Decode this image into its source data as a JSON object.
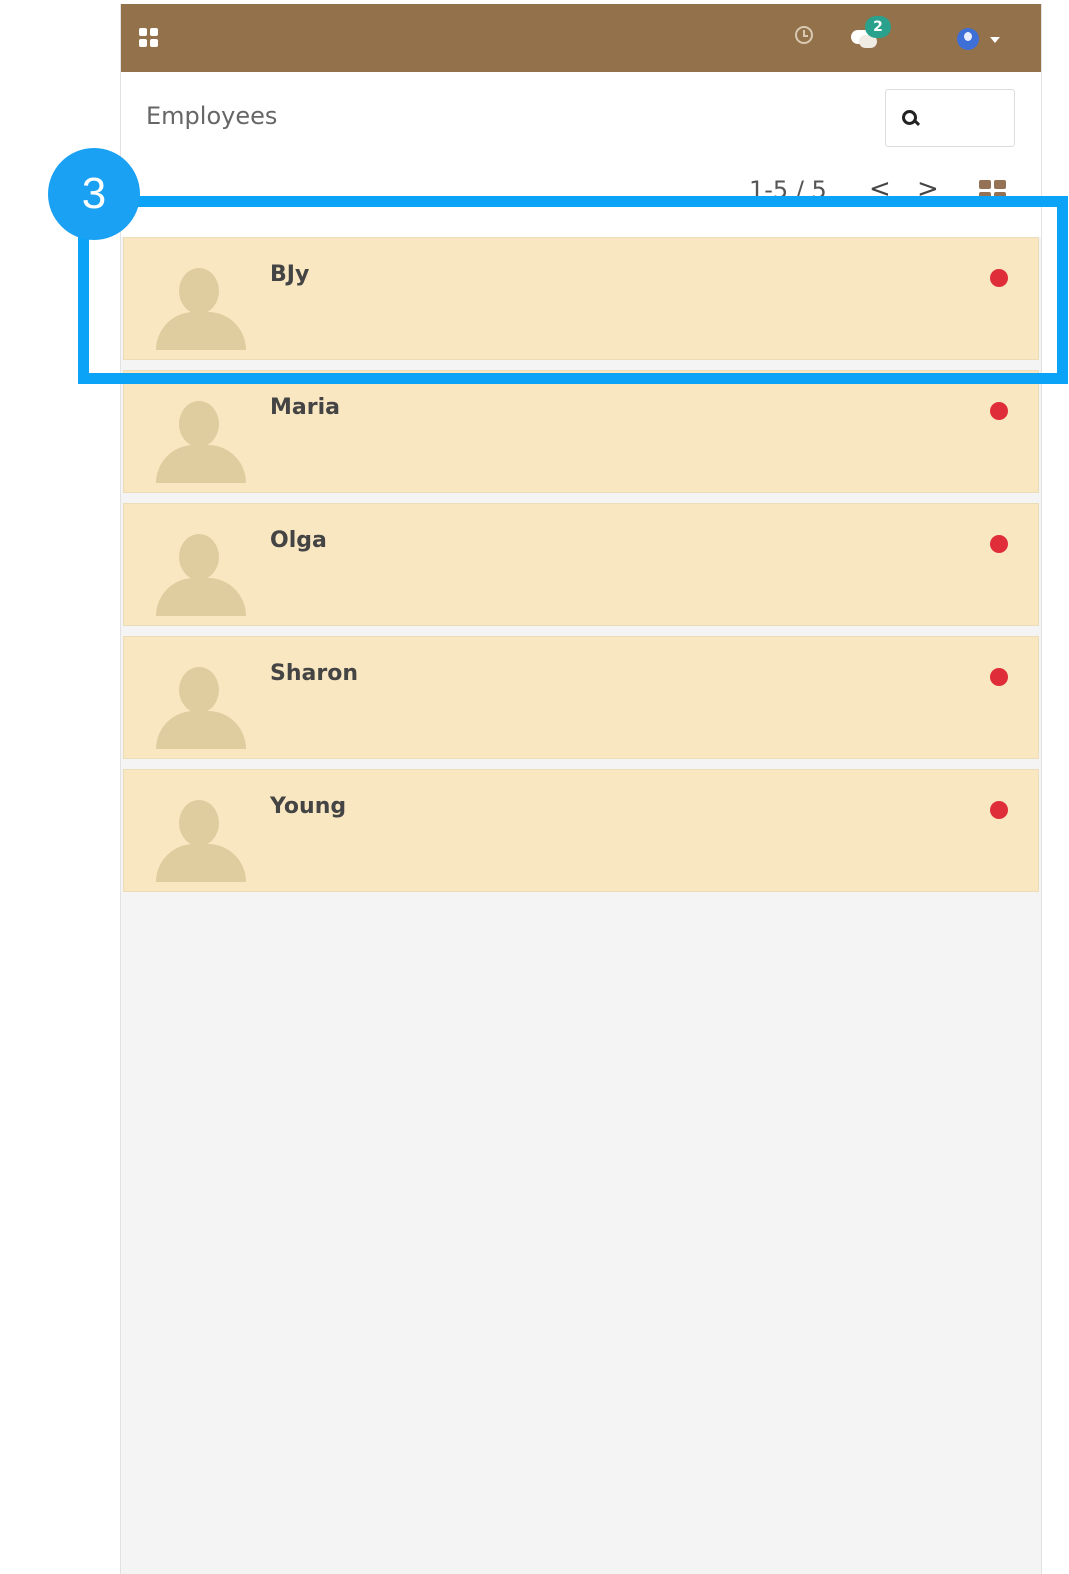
{
  "page": {
    "title": "Employees"
  },
  "topbar": {
    "chat_badge": "2"
  },
  "pager": {
    "range": "1-5 / 5",
    "prev": "<",
    "next": ">"
  },
  "employees": [
    {
      "name": "BJy",
      "status_color": "#df2d3a"
    },
    {
      "name": "Maria",
      "status_color": "#df2d3a"
    },
    {
      "name": "Olga",
      "status_color": "#df2d3a"
    },
    {
      "name": "Sharon",
      "status_color": "#df2d3a"
    },
    {
      "name": "Young",
      "status_color": "#df2d3a"
    }
  ],
  "callout": {
    "number": "3"
  },
  "icons": [
    "apps-icon",
    "clock-icon",
    "chat-icon",
    "user-avatar-icon",
    "search-icon",
    "kanban-view-icon"
  ],
  "colors": {
    "topbar": "#93714a",
    "card": "#f9e7c2",
    "status": "#df2d3a",
    "callout": "#0aa3f7"
  }
}
